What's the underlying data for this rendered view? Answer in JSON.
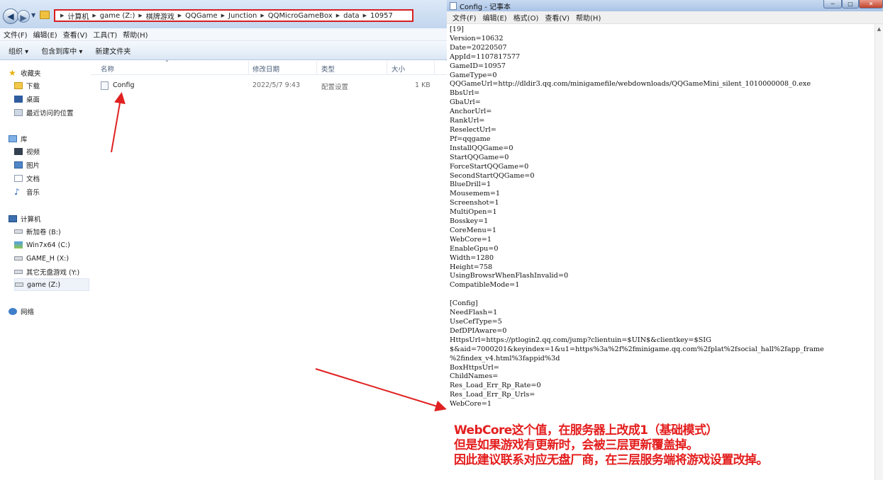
{
  "explorer": {
    "breadcrumbs": [
      "计算机",
      "game (Z:)",
      "棋牌游戏",
      "QQGame",
      "Junction",
      "QQMicroGameBox",
      "data",
      "10957"
    ],
    "menu": [
      "文件(F)",
      "编辑(E)",
      "查看(V)",
      "工具(T)",
      "帮助(H)"
    ],
    "toolbar": {
      "organize": "组织 ▾",
      "include": "包含到库中 ▾",
      "new_folder": "新建文件夹"
    },
    "nav": {
      "favorites": "收藏夹",
      "fav_items": [
        "下载",
        "桌面",
        "最近访问的位置"
      ],
      "libraries": "库",
      "lib_items": [
        "视频",
        "图片",
        "文档",
        "音乐"
      ],
      "computer": "计算机",
      "drives": [
        "新加卷 (B:)",
        "Win7x64 (C:)",
        "GAME_H (X:)",
        "其它无盘游戏 (Y:)",
        "game (Z:)"
      ],
      "network": "网络"
    },
    "columns": [
      "名称",
      "修改日期",
      "类型",
      "大小"
    ],
    "file": {
      "name": "Config",
      "date": "2022/5/7 9:43",
      "type": "配置设置",
      "size": "1 KB"
    }
  },
  "notepad": {
    "title": "Config - 记事本",
    "menu": [
      "文件(F)",
      "编辑(E)",
      "格式(O)",
      "查看(V)",
      "帮助(H)"
    ],
    "lines": [
      "[19]",
      "Version=10632",
      "Date=20220507",
      "AppId=1107817577",
      "GameID=10957",
      "GameType=0",
      "QQGameUrl=http://dldir3.qq.com/minigamefile/webdownloads/QQGameMini_silent_1010000008_0.exe",
      "BbsUrl=",
      "GbaUrl=",
      "AnchorUrl=",
      "RankUrl=",
      "ReselectUrl=",
      "Pf=qqgame",
      "InstallQQGame=0",
      "StartQQGame=0",
      "ForceStartQQGame=0",
      "SecondStartQQGame=0",
      "BlueDrill=1",
      "Mousemem=1",
      "Screenshot=1",
      "MultiOpen=1",
      "Bosskey=1",
      "CoreMenu=1",
      "WebCore=1",
      "EnableGpu=0",
      "Width=1280",
      "Height=758",
      "UsingBrowsrWhenFlashInvalid=0",
      "CompatibleMode=1",
      "",
      "[Config]",
      "NeedFlash=1",
      "UseCefType=5",
      "DefDPIAware=0",
      "HttpsUrl=https://ptlogin2.qq.com/jump?clientuin=$UIN$&clientkey=$SIG",
      "$&aid=7000201&keyindex=1&u1=https%3a%2f%2fminigame.qq.com%2fplat%2fsocial_hall%2fapp_frame",
      "%2findex_v4.html%3fappid%3d",
      "BoxHttpsUrl=",
      "ChildNames=",
      "Res_Load_Err_Rp_Rate=0",
      "Res_Load_Err_Rp_Urls=",
      "WebCore=1"
    ]
  },
  "annotation": {
    "line1": "WebCore这个值，在服务器上改成1（基础模式）",
    "line2": "但是如果游戏有更新时，会被三层更新覆盖掉。",
    "line3": "因此建议联系对应无盘厂商，在三层服务端将游戏设置改掉。"
  },
  "colors": {
    "highlight_box": "#d71f1f",
    "annotation_text": "#e41e1e",
    "arrow": "#e02020"
  }
}
